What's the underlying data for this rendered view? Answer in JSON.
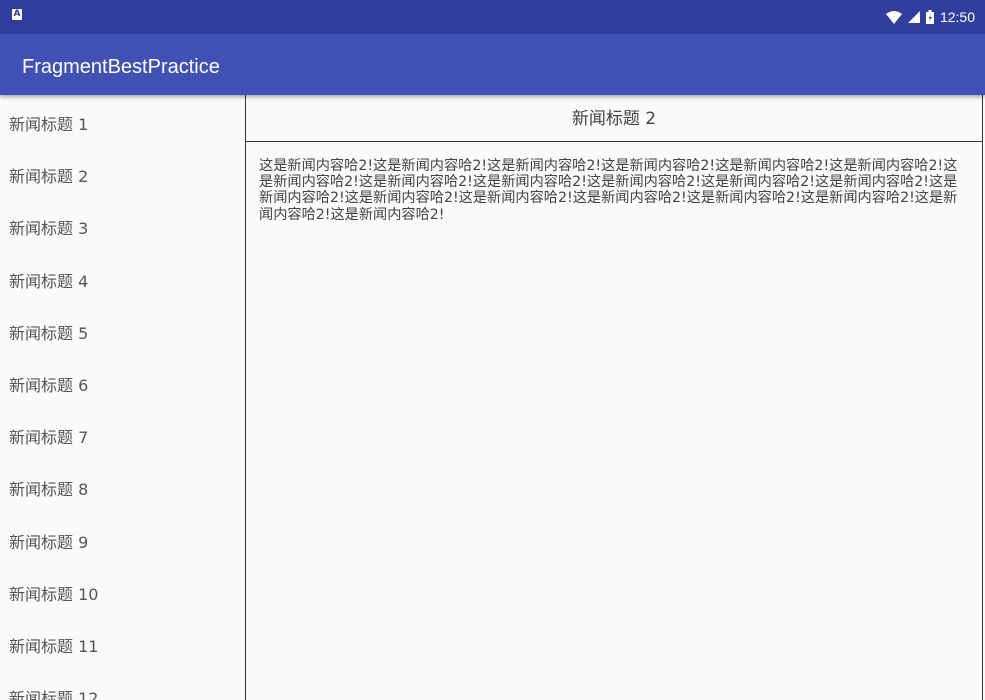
{
  "status_bar": {
    "time": "12:50",
    "notification_icon": "a-notification-icon",
    "icons": [
      "wifi-icon",
      "signal-icon",
      "battery-icon"
    ]
  },
  "app_bar": {
    "title": "FragmentBestPractice"
  },
  "news_list": {
    "items": [
      {
        "label": "新闻标题 1"
      },
      {
        "label": "新闻标题 2"
      },
      {
        "label": "新闻标题 3"
      },
      {
        "label": "新闻标题 4"
      },
      {
        "label": "新闻标题 5"
      },
      {
        "label": "新闻标题 6"
      },
      {
        "label": "新闻标题 7"
      },
      {
        "label": "新闻标题 8"
      },
      {
        "label": "新闻标题 9"
      },
      {
        "label": "新闻标题 10"
      },
      {
        "label": "新闻标题 11"
      },
      {
        "label": "新闻标题 12"
      }
    ]
  },
  "news_detail": {
    "title": "新闻标题 2",
    "content": "这是新闻内容哈2!这是新闻内容哈2!这是新闻内容哈2!这是新闻内容哈2!这是新闻内容哈2!这是新闻内容哈2!这是新闻内容哈2!这是新闻内容哈2!这是新闻内容哈2!这是新闻内容哈2!这是新闻内容哈2!这是新闻内容哈2!这是新闻内容哈2!这是新闻内容哈2!这是新闻内容哈2!这是新闻内容哈2!这是新闻内容哈2!这是新闻内容哈2!这是新闻内容哈2!这是新闻内容哈2!"
  },
  "colors": {
    "status_bar": "#303f9f",
    "app_bar": "#3f51b5",
    "background": "#fafafa",
    "text": "#444444"
  }
}
